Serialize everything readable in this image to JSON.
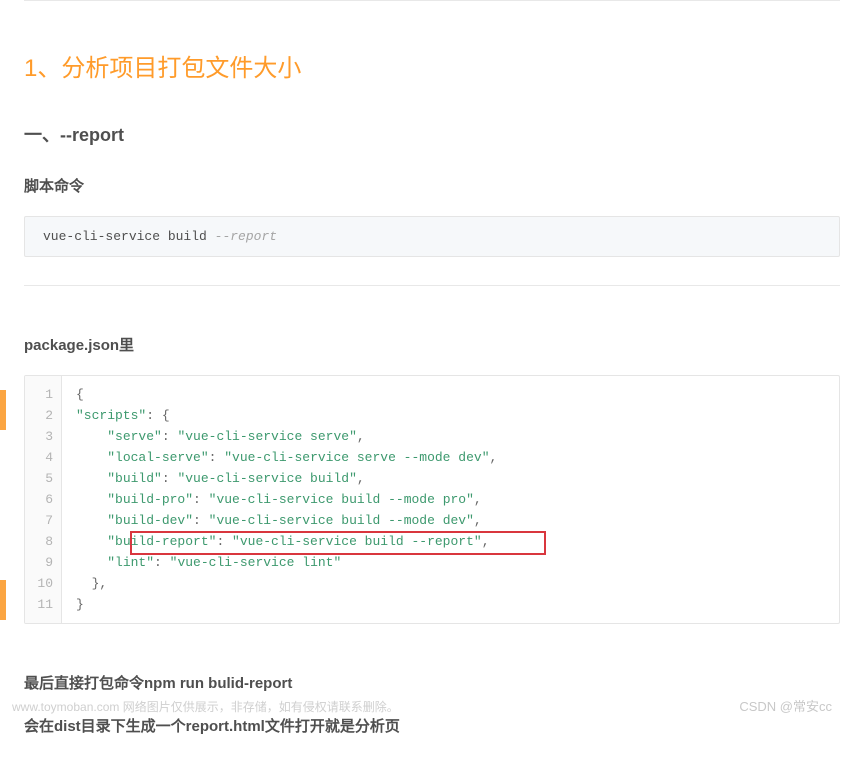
{
  "heading_main": "1、分析项目打包文件大小",
  "heading_sub1": "一、--report",
  "heading_script": "脚本命令",
  "cmd": {
    "base": "vue-cli-service build ",
    "flag": "--report"
  },
  "heading_pkg": "package.json里",
  "code": {
    "lines": [
      {
        "n": "1",
        "t": "plain",
        "text": "{"
      },
      {
        "n": "2",
        "t": "kopen",
        "key": "scripts",
        "after": ": {"
      },
      {
        "n": "3",
        "t": "kv",
        "indent": "    ",
        "key": "serve",
        "val": "vue-cli-service serve",
        "trail": ","
      },
      {
        "n": "4",
        "t": "kv",
        "indent": "    ",
        "key": "local-serve",
        "val": "vue-cli-service serve --mode dev",
        "trail": ","
      },
      {
        "n": "5",
        "t": "kv",
        "indent": "    ",
        "key": "build",
        "val": "vue-cli-service build",
        "trail": ","
      },
      {
        "n": "6",
        "t": "kv",
        "indent": "    ",
        "key": "build-pro",
        "val": "vue-cli-service build --mode pro",
        "trail": ","
      },
      {
        "n": "7",
        "t": "kv",
        "indent": "    ",
        "key": "build-dev",
        "val": "vue-cli-service build --mode dev",
        "trail": ","
      },
      {
        "n": "8",
        "t": "kv",
        "indent": "    ",
        "key": "build-report",
        "val": "vue-cli-service build --report",
        "trail": ","
      },
      {
        "n": "9",
        "t": "kv",
        "indent": "    ",
        "key": "lint",
        "val": "vue-cli-service lint",
        "trail": ""
      },
      {
        "n": "10",
        "t": "plain",
        "text": "  },"
      },
      {
        "n": "11",
        "t": "plain",
        "text": "}"
      }
    ]
  },
  "para1": "最后直接打包命令npm run bulid-report",
  "para2": "会在dist目录下生成一个report.html文件打开就是分析页",
  "watermark_left": "www.toymoban.com  网络图片仅供展示，非存储，如有侵权请联系删除。",
  "watermark_right": "CSDN @常安cc"
}
